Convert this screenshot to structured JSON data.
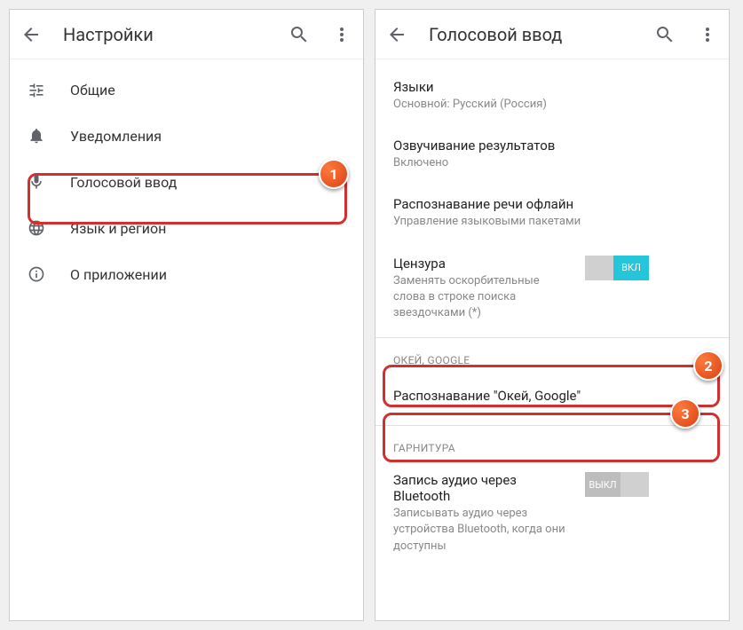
{
  "left": {
    "title": "Настройки",
    "items": [
      {
        "label": "Общие"
      },
      {
        "label": "Уведомления"
      },
      {
        "label": "Голосовой ввод"
      },
      {
        "label": "Язык и регион"
      },
      {
        "label": "О приложении"
      }
    ]
  },
  "right": {
    "title": "Голосовой ввод",
    "languages": {
      "title": "Языки",
      "sub": "Основной: Русский (Россия)"
    },
    "speech_output": {
      "title": "Озвучивание результатов",
      "sub": "Включено"
    },
    "offline": {
      "title": "Распознавание речи офлайн",
      "sub": "Управление языковыми пакетами"
    },
    "censor": {
      "title": "Цензура",
      "sub": "Заменять оскорбительные слова в строке поиска звездочками (*)",
      "toggle": "ВКЛ"
    },
    "section_ok": "ОКЕЙ, GOOGLE",
    "ok_google": {
      "title": "Распознавание \"Окей, Google\""
    },
    "section_headset": "ГАРНИТУРА",
    "bt_audio": {
      "title": "Запись аудио через Bluetooth",
      "sub": "Записывать аудио через устройства Bluetooth, когда они доступны",
      "toggle": "ВЫКЛ"
    }
  },
  "markers": {
    "m1": "1",
    "m2": "2",
    "m3": "3"
  }
}
